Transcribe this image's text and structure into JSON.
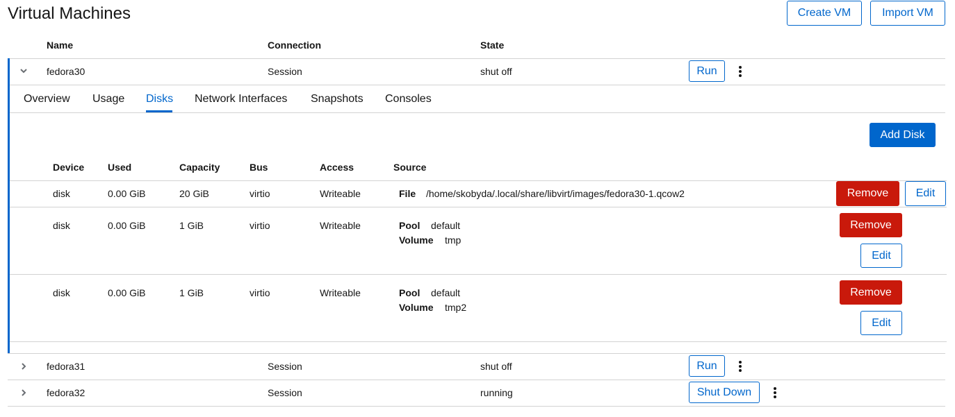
{
  "header": {
    "title": "Virtual Machines",
    "create_vm": "Create VM",
    "import_vm": "Import VM"
  },
  "vm_table": {
    "columns": [
      "Name",
      "Connection",
      "State"
    ],
    "rows": [
      {
        "name": "fedora30",
        "connection": "Session",
        "state": "shut off",
        "action": "Run",
        "expanded": true
      },
      {
        "name": "fedora31",
        "connection": "Session",
        "state": "shut off",
        "action": "Run",
        "expanded": false
      },
      {
        "name": "fedora32",
        "connection": "Session",
        "state": "running",
        "action": "Shut Down",
        "expanded": false
      }
    ]
  },
  "tabs": [
    "Overview",
    "Usage",
    "Disks",
    "Network Interfaces",
    "Snapshots",
    "Consoles"
  ],
  "active_tab": "Disks",
  "disks": {
    "add_disk": "Add Disk",
    "columns": [
      "Device",
      "Used",
      "Capacity",
      "Bus",
      "Access",
      "Source"
    ],
    "remove_label": "Remove",
    "edit_label": "Edit",
    "rows": [
      {
        "device": "disk",
        "used": "0.00 GiB",
        "capacity": "20 GiB",
        "bus": "virtio",
        "access": "Writeable",
        "source": {
          "file_label": "File",
          "file": "/home/skobyda/.local/share/libvirt/images/fedora30-1.qcow2"
        }
      },
      {
        "device": "disk",
        "used": "0.00 GiB",
        "capacity": "1 GiB",
        "bus": "virtio",
        "access": "Writeable",
        "source": {
          "pool_label": "Pool",
          "pool": "default",
          "volume_label": "Volume",
          "volume": "tmp"
        }
      },
      {
        "device": "disk",
        "used": "0.00 GiB",
        "capacity": "1 GiB",
        "bus": "virtio",
        "access": "Writeable",
        "source": {
          "pool_label": "Pool",
          "pool": "default",
          "volume_label": "Volume",
          "volume": "tmp2"
        }
      }
    ]
  },
  "colors": {
    "accent": "#0066cc",
    "danger": "#c9190b",
    "border": "#d2d2d2"
  }
}
